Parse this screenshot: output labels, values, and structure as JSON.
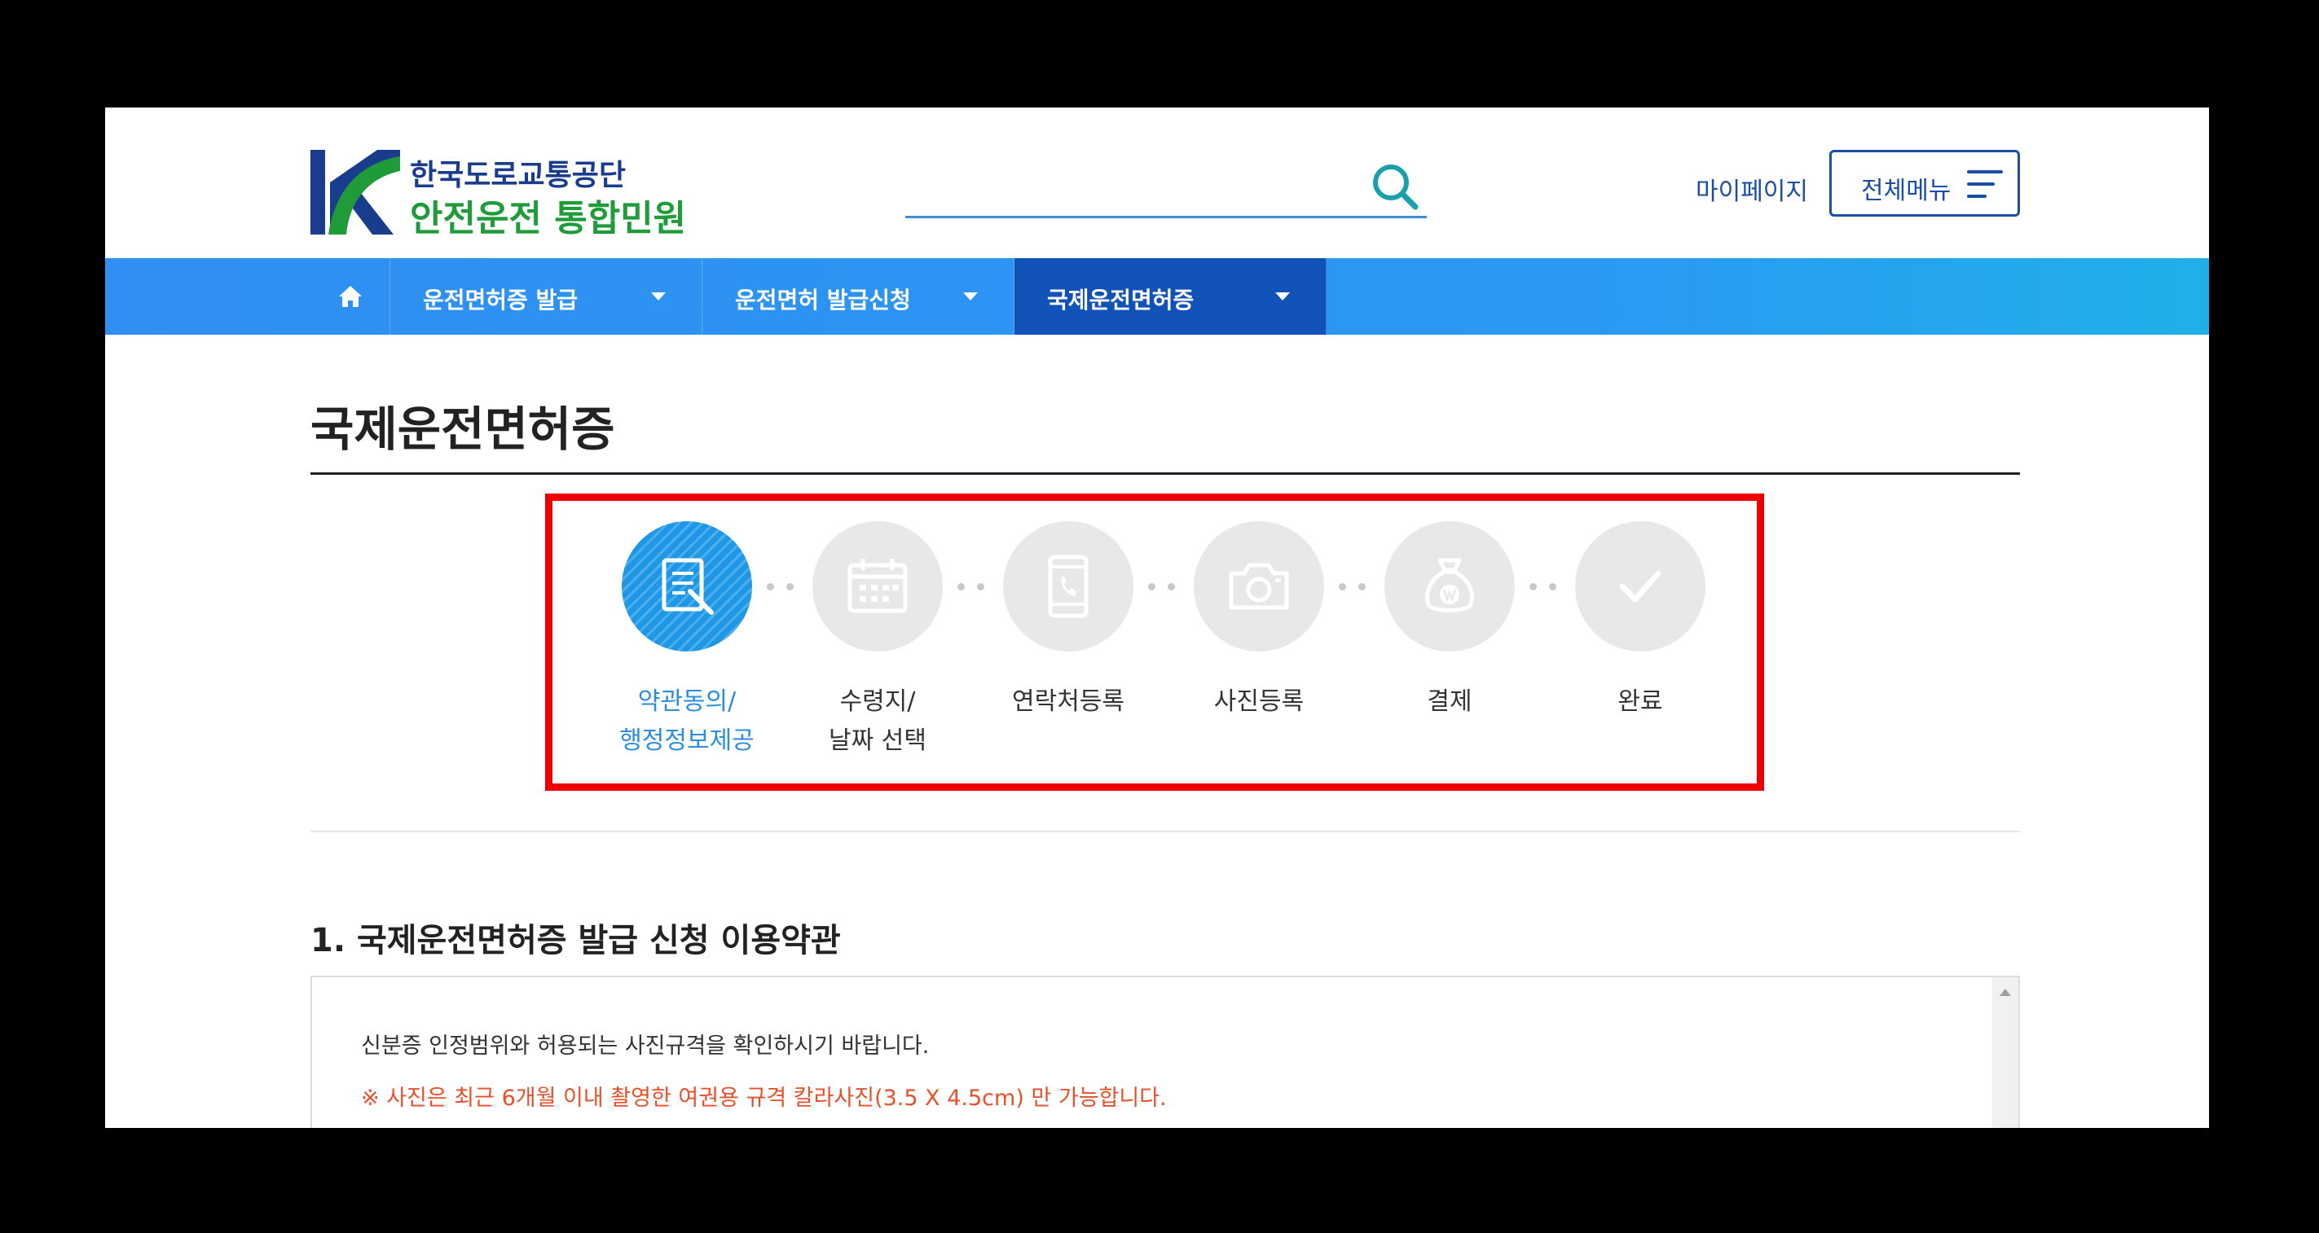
{
  "header": {
    "logo_line1": "한국도로교통공단",
    "logo_line2": "안전운전 통합민원",
    "search_placeholder": "",
    "mypage_label": "마이페이지",
    "allmenu_label": "전체메뉴"
  },
  "nav": {
    "items": [
      {
        "label": "운전면허증 발급"
      },
      {
        "label": "운전면허 발급신청"
      },
      {
        "label": "국제운전면허증",
        "active": true
      }
    ]
  },
  "main": {
    "page_title": "국제운전면허증",
    "steps": [
      {
        "line1": "약관동의/",
        "line2": "행정정보제공",
        "icon": "document-pen-icon",
        "active": true
      },
      {
        "line1": "수령지/",
        "line2": "날짜 선택",
        "icon": "calendar-icon"
      },
      {
        "line1": "연락처등록",
        "line2": "",
        "icon": "phone-icon"
      },
      {
        "line1": "사진등록",
        "line2": "",
        "icon": "camera-icon"
      },
      {
        "line1": "결제",
        "line2": "",
        "icon": "money-bag-icon"
      },
      {
        "line1": "완료",
        "line2": "",
        "icon": "check-icon"
      }
    ],
    "section_heading": "1. 국제운전면허증 발급 신청 이용약관",
    "terms_line1": "신분증 인정범위와 허용되는 사진규격을 확인하시기 바랍니다.",
    "terms_line2": "※ 사진은 최근 6개월 이내 촬영한 여권용 규격 칼라사진(3.5 X 4.5cm) 만 가능합니다."
  },
  "colors": {
    "nav_blue": "#2f8ff2",
    "nav_active": "#1152b8",
    "accent_blue": "#2a8de0",
    "highlight_frame": "#ee0000",
    "notice_orange": "#e8502a"
  }
}
